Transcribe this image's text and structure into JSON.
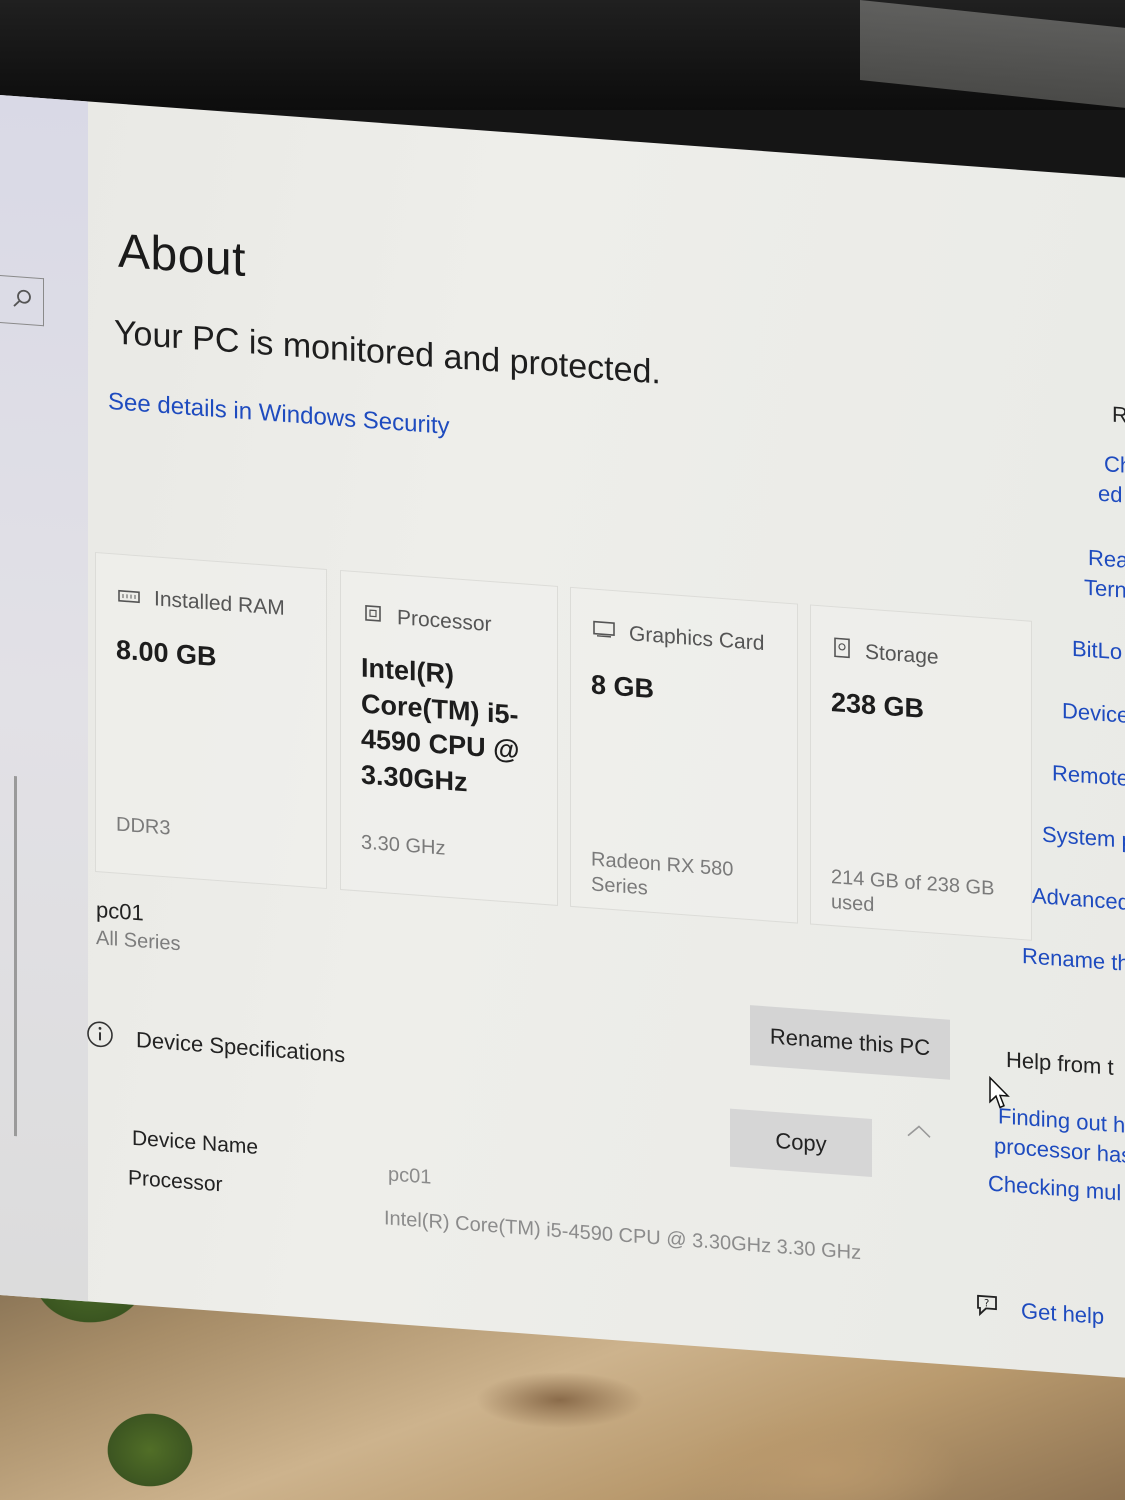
{
  "page": {
    "title": "About",
    "status": "Your PC is monitored and protected.",
    "security_link": "See details in Windows Security"
  },
  "cards": [
    {
      "icon": "ram-icon",
      "label": "Installed RAM",
      "value": "8.00 GB",
      "sub": "DDR3"
    },
    {
      "icon": "processor-icon",
      "label": "Processor",
      "value": "Intel(R) Core(TM) i5-4590 CPU @ 3.30GHz",
      "sub": "3.30 GHz"
    },
    {
      "icon": "graphics-card-icon",
      "label": "Graphics Card",
      "value": "8 GB",
      "sub": "Radeon RX 580 Series"
    },
    {
      "icon": "storage-icon",
      "label": "Storage",
      "value": "238 GB",
      "sub": "214 GB of 238 GB used"
    }
  ],
  "device": {
    "name": "pc01",
    "series": "All Series",
    "rename_button": "Rename this PC"
  },
  "specs": {
    "heading": "Device Specifications",
    "copy_button": "Copy",
    "rows": [
      {
        "label": "Device Name",
        "value": "pc01"
      },
      {
        "label": "Processor",
        "value": "Intel(R) Core(TM) i5-4590 CPU @ 3.30GHz   3.30 GHz"
      }
    ]
  },
  "related": {
    "links": [
      "R",
      "Ch",
      "ed",
      "Rea",
      "Tern",
      "BitLo",
      "Device",
      "Remote",
      "System p",
      "Advanced",
      "Rename th"
    ],
    "help_heading": "Help from t",
    "help_links": [
      "Finding out h",
      "processor has",
      "Checking mul"
    ],
    "get_help": "Get help"
  }
}
